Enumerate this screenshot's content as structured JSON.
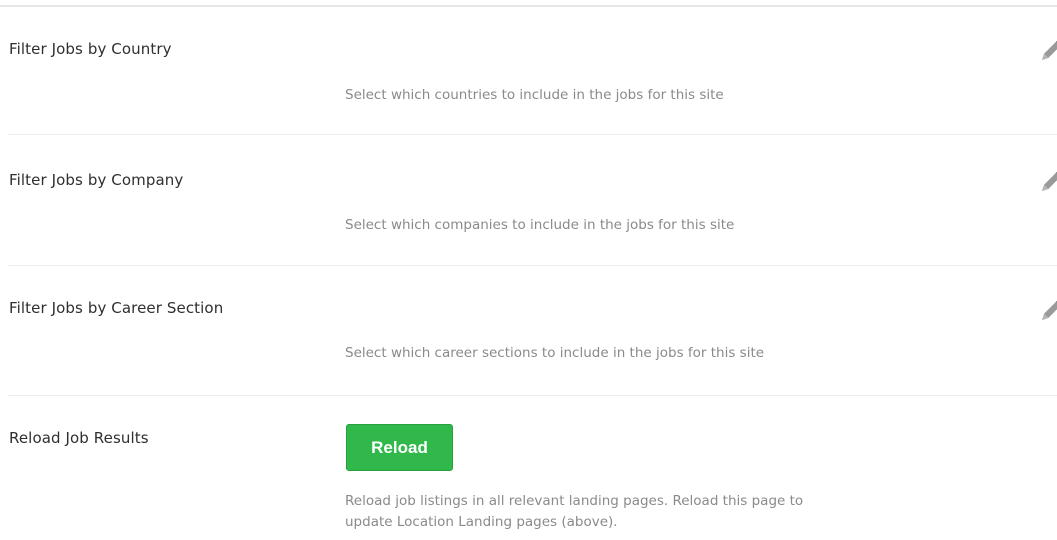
{
  "settings": {
    "rows": [
      {
        "label": "Filter Jobs by Country",
        "description": "Select which countries to include in the jobs for this site",
        "edit_icon": "pencil-icon"
      },
      {
        "label": "Filter Jobs by Company",
        "description": "Select which companies to include in the jobs for this site",
        "edit_icon": "pencil-icon"
      },
      {
        "label": "Filter Jobs by Career Section",
        "description": "Select which career sections to include in the jobs for this site",
        "edit_icon": "pencil-icon"
      }
    ],
    "reload": {
      "label": "Reload Job Results",
      "button_label": "Reload",
      "description_line1": "Reload job listings in all relevant landing pages. Reload this page to",
      "description_line2": "update Location Landing pages (above)."
    }
  },
  "colors": {
    "button_green": "#30b84a",
    "label_text": "#2f2f2f",
    "description_text": "#8a8a8a",
    "divider": "#ececec",
    "icon_gray": "#9a9a9a"
  }
}
